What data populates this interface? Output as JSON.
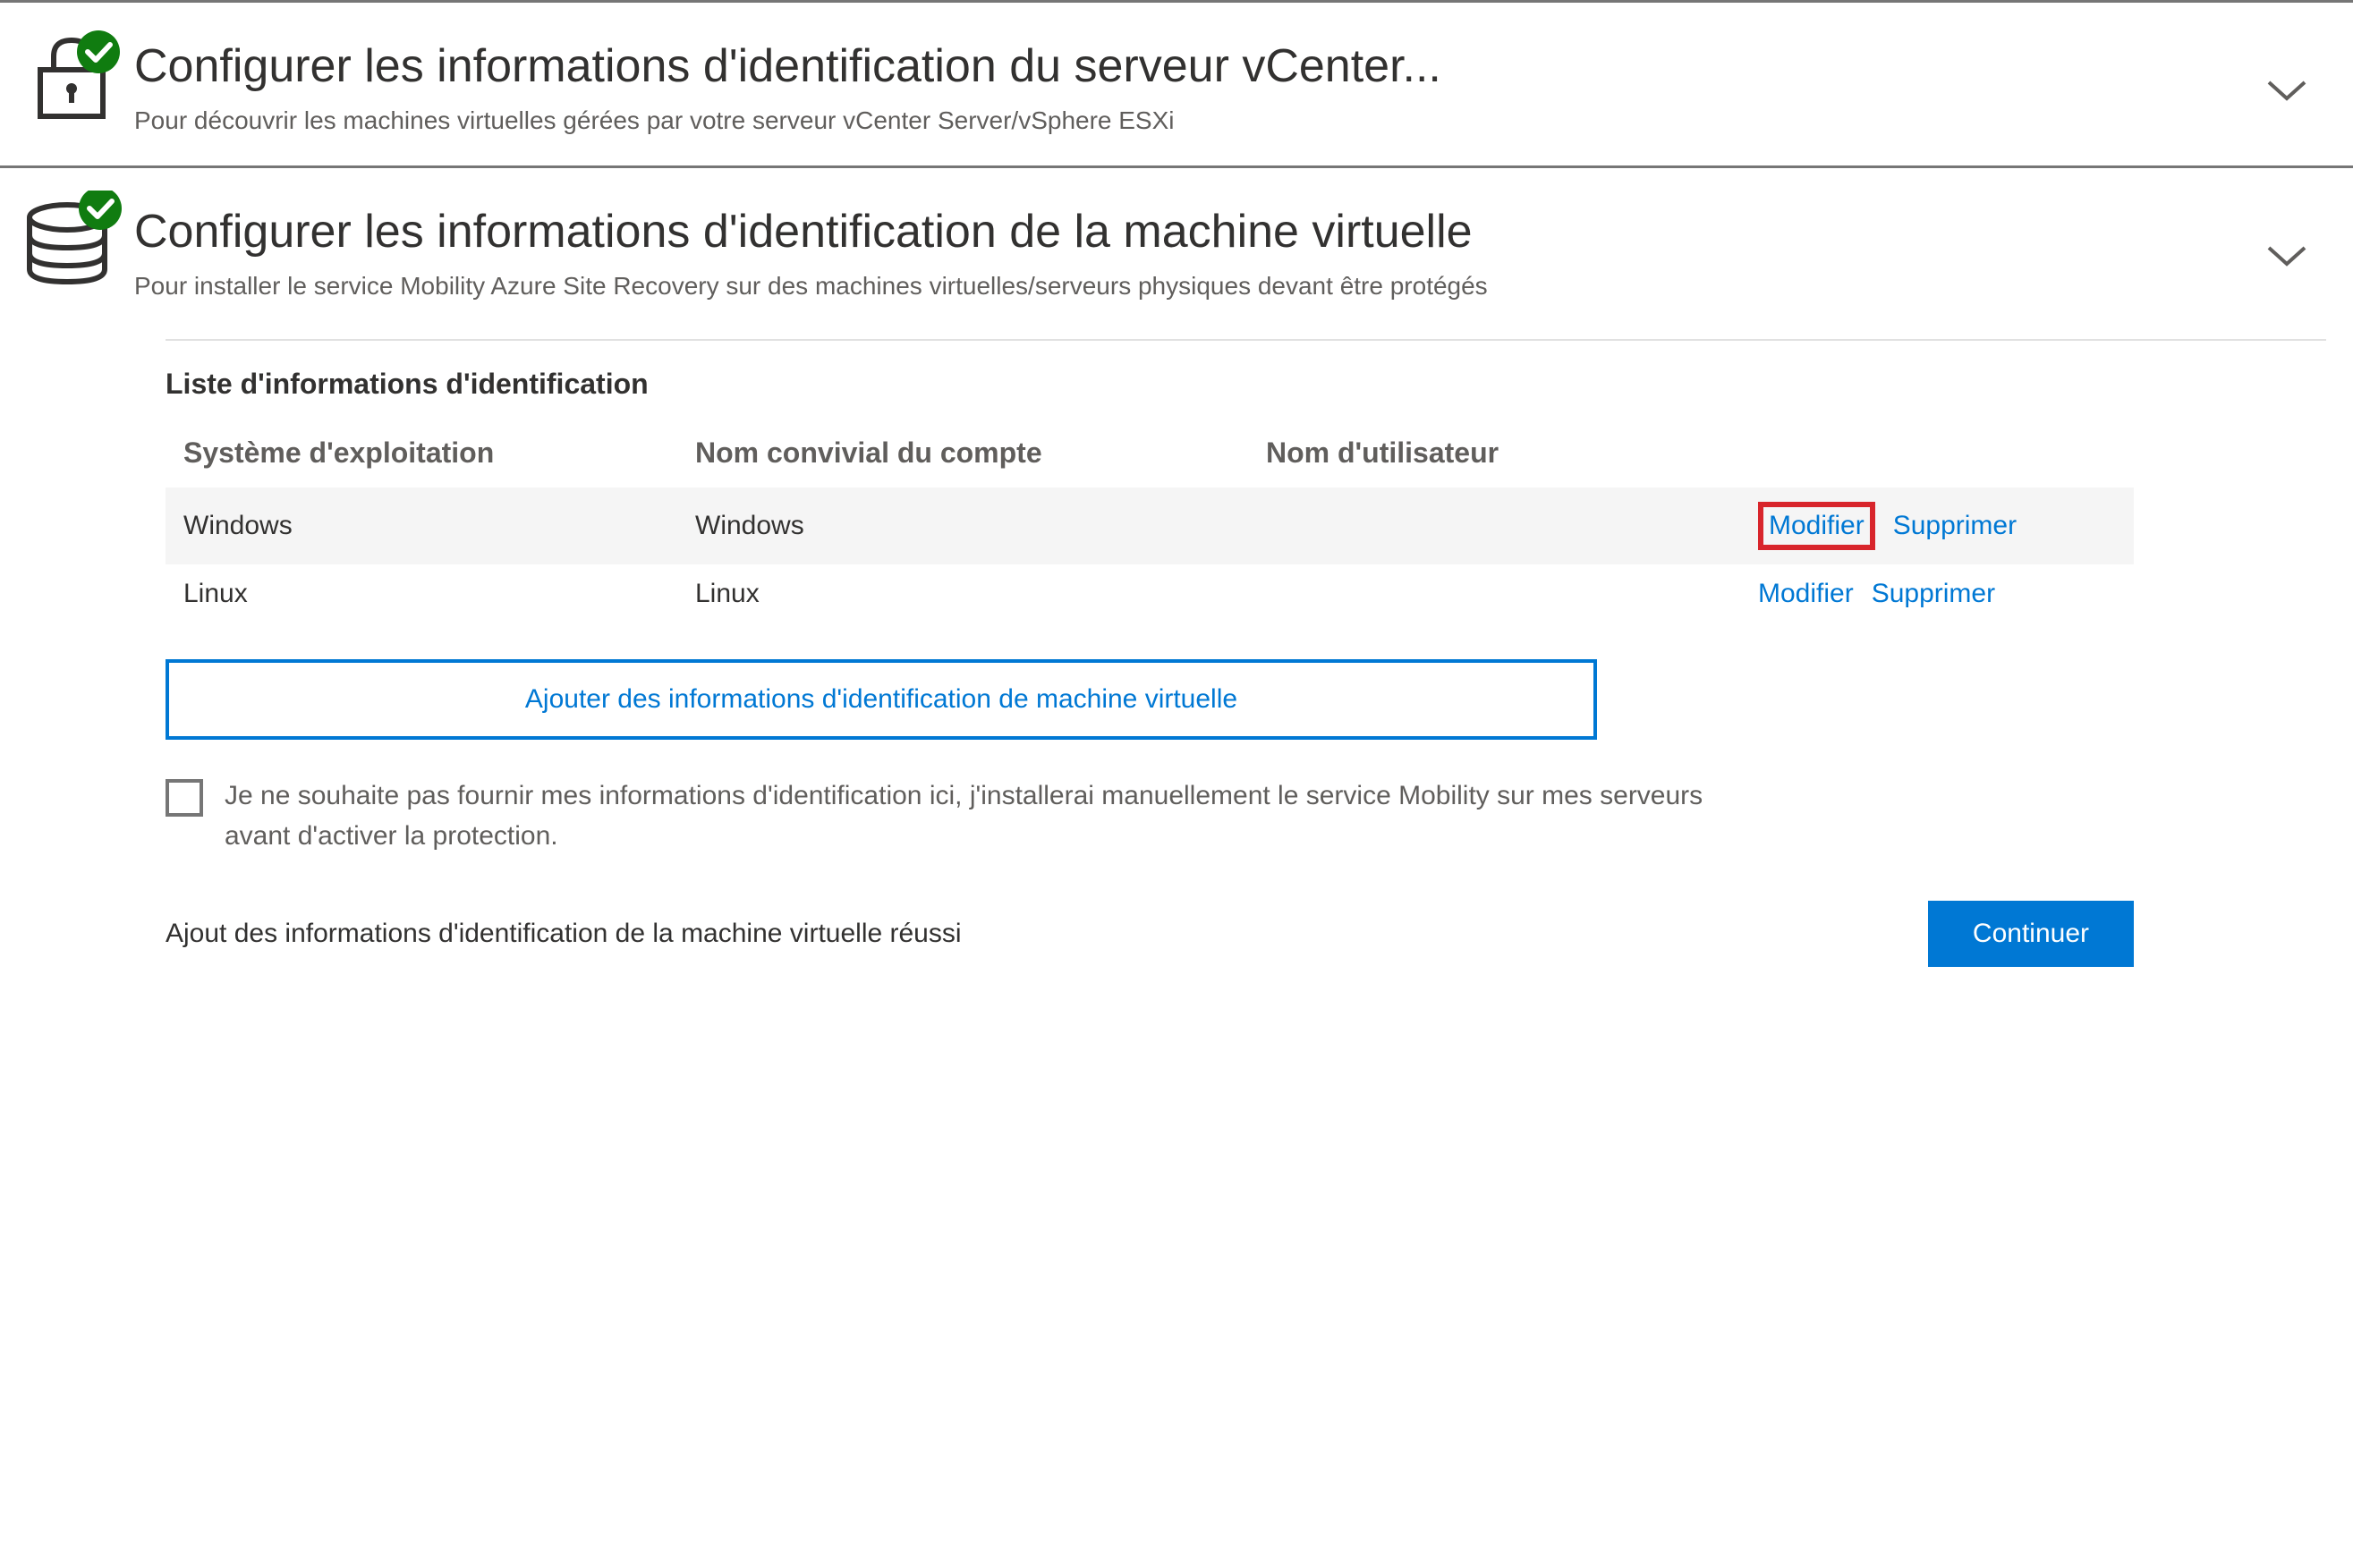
{
  "section1": {
    "title": "Configurer les informations d'identification du serveur vCenter...",
    "subtitle": "Pour découvrir les machines virtuelles gérées par votre serveur vCenter Server/vSphere ESXi"
  },
  "section2": {
    "title": "Configurer les informations d'identification de la machine virtuelle",
    "subtitle": "Pour installer le service Mobility Azure Site Recovery sur des machines virtuelles/serveurs physiques devant être protégés"
  },
  "credentials": {
    "list_title": "Liste d'informations d'identification",
    "headers": {
      "os": "Système d'exploitation",
      "friendly_name": "Nom convivial du compte",
      "username": "Nom d'utilisateur"
    },
    "rows": [
      {
        "os": "Windows",
        "friendly_name": "Windows",
        "username": "",
        "edit_label": "Modifier",
        "delete_label": "Supprimer",
        "highlighted": true
      },
      {
        "os": "Linux",
        "friendly_name": "Linux",
        "username": "",
        "edit_label": "Modifier",
        "delete_label": "Supprimer",
        "highlighted": false
      }
    ],
    "add_button_label": "Ajouter des informations d'identification de machine virtuelle",
    "skip_checkbox_label": "Je ne souhaite pas fournir mes informations d'identification ici, j'installerai manuellement le service Mobility sur mes serveurs avant d'activer la protection.",
    "status_message": "Ajout des informations d'identification de la machine virtuelle réussi",
    "continue_label": "Continuer"
  },
  "colors": {
    "accent": "#0078d4",
    "success": "#107c10",
    "highlight": "#d8252b"
  }
}
